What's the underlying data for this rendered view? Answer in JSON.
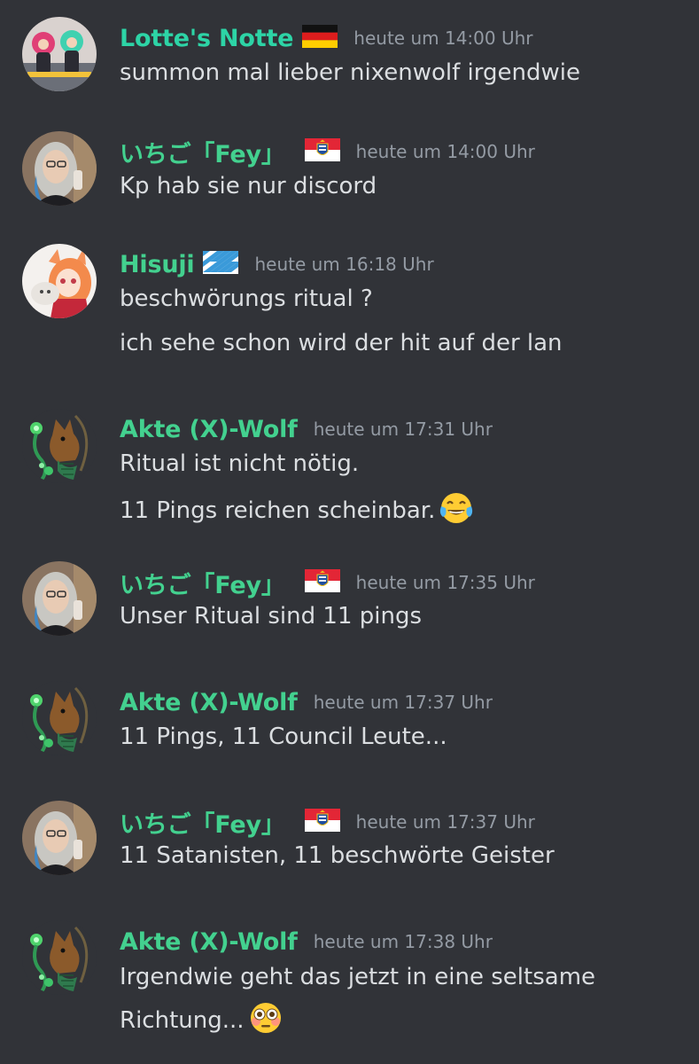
{
  "colors": {
    "background": "#313338",
    "name_teal": "#2dd4a6",
    "name_green": "#43d18f",
    "message_text": "#dbdee1",
    "timestamp": "#949ba4"
  },
  "messages": [
    {
      "author": "Lotte's Notte",
      "flag": "germany-flag",
      "timestamp": "heute um 14:00 Uhr",
      "lines": [
        "summon mal lieber nixenwolf irgendwie"
      ]
    },
    {
      "author": "いちご「Fey」",
      "flag": "hessen-flag",
      "timestamp": "heute um 14:00 Uhr",
      "lines": [
        "Kp hab sie nur discord"
      ]
    },
    {
      "author": "Hisuji",
      "flag": "bavaria-flag",
      "timestamp": "heute um 16:18 Uhr",
      "lines": [
        "beschwörungs ritual ?",
        "ich sehe schon wird der hit auf der lan"
      ]
    },
    {
      "author": "Akte (X)-Wolf",
      "timestamp": "heute um 17:31 Uhr",
      "lines": [
        "Ritual ist nicht nötig.",
        "11 Pings reichen scheinbar."
      ],
      "emoji": "tears-of-joy-emoji"
    },
    {
      "author": "いちご「Fey」",
      "flag": "hessen-flag",
      "timestamp": "heute um 17:35 Uhr",
      "lines": [
        "Unser Ritual sind 11 pings"
      ]
    },
    {
      "author": "Akte (X)-Wolf",
      "timestamp": "heute um 17:37 Uhr",
      "lines": [
        "11 Pings, 11 Council Leute..."
      ]
    },
    {
      "author": "いちご「Fey」",
      "flag": "hessen-flag",
      "timestamp": "heute um 17:37 Uhr",
      "lines": [
        "11 Satanisten, 11 beschwörte Geister"
      ]
    },
    {
      "author": "Akte (X)-Wolf",
      "timestamp": "heute um 17:38 Uhr",
      "lines": [
        "Irgendwie geht das jetzt in eine seltsame",
        "Richtung..."
      ],
      "emoji": "flushed-face-emoji"
    }
  ]
}
